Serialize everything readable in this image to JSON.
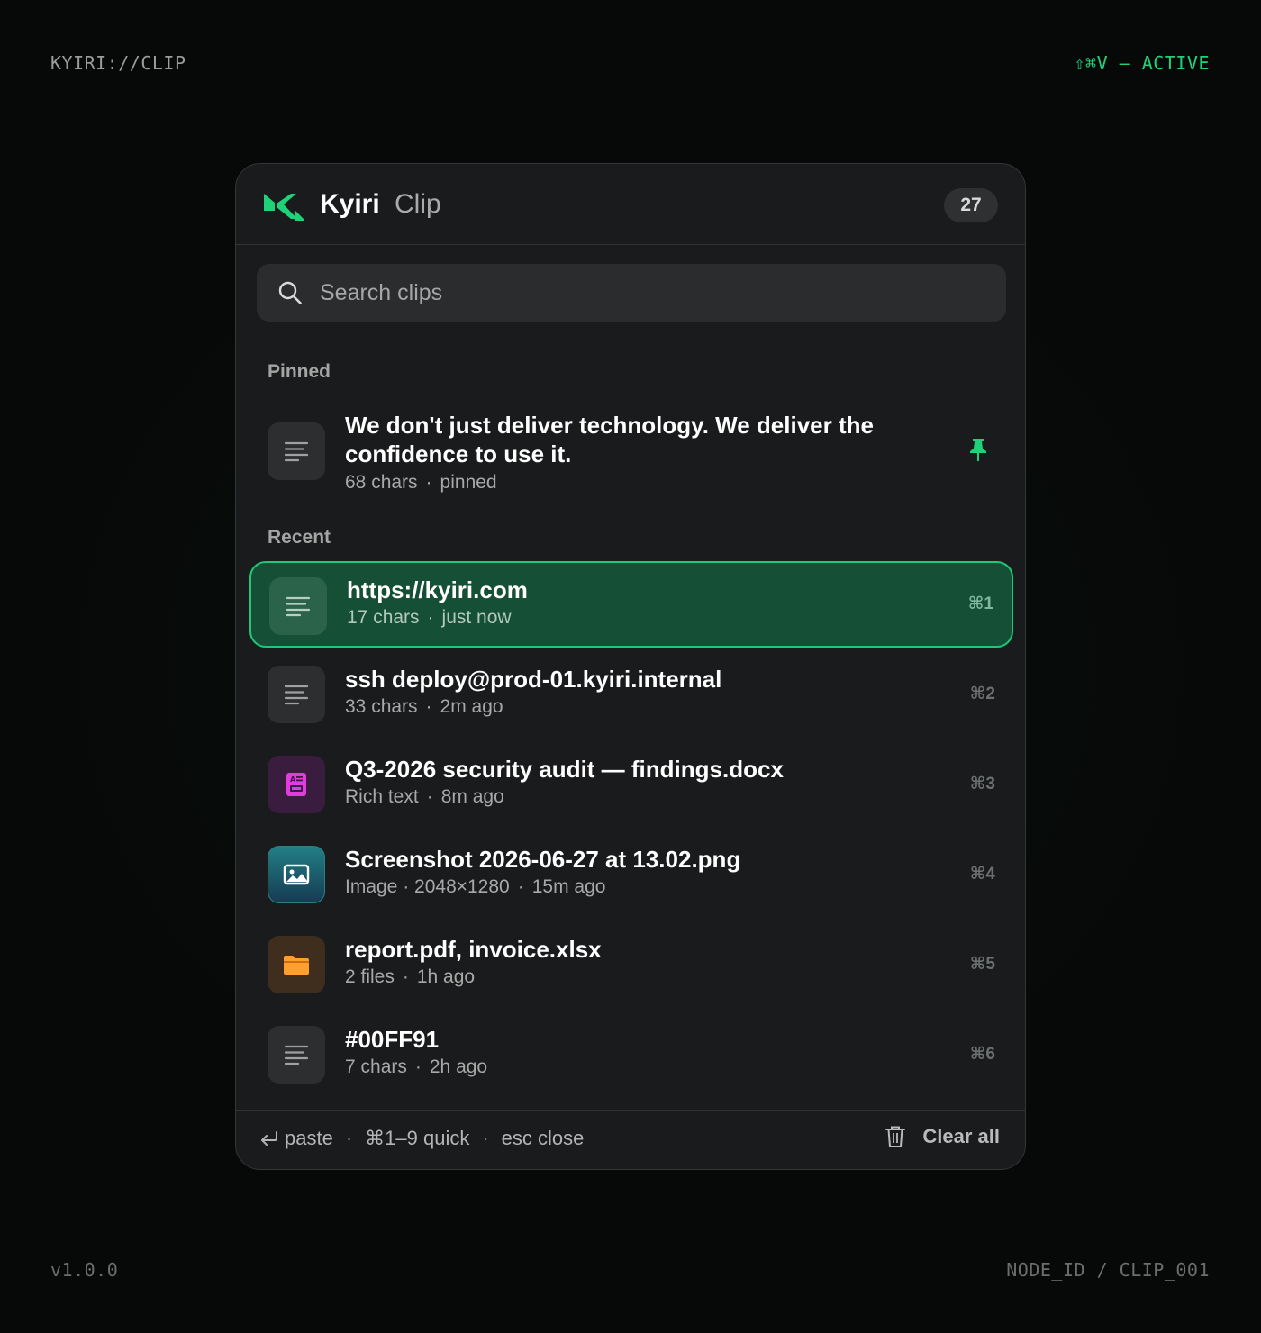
{
  "corners": {
    "top_left": "KYIRI://CLIP",
    "top_right": "⇧⌘V — ACTIVE",
    "bottom_left": "v1.0.0",
    "bottom_right": "NODE_ID / CLIP_001"
  },
  "header": {
    "brand": "Kyiri",
    "product": "Clip",
    "count": "27"
  },
  "search": {
    "placeholder": "Search clips",
    "value": ""
  },
  "sections": {
    "pinned": "Pinned",
    "recent": "Recent"
  },
  "pinned_item": {
    "title": "We don't just deliver technology. We deliver the confidence to use it.",
    "meta_a": "68 chars",
    "meta_b": "pinned",
    "icon": "text-lines-icon"
  },
  "recent_items": [
    {
      "title": "https://kyiri.com",
      "meta_a": "17 chars",
      "meta_b": "just now",
      "shortcut": "⌘1",
      "type": "text",
      "selected": true
    },
    {
      "title": "ssh deploy@prod-01.kyiri.internal",
      "meta_a": "33 chars",
      "meta_b": "2m ago",
      "shortcut": "⌘2",
      "type": "text"
    },
    {
      "title": "Q3-2026 security audit — findings.docx",
      "meta_a": "Rich text",
      "meta_b": "8m ago",
      "shortcut": "⌘3",
      "type": "rich"
    },
    {
      "title": "Screenshot 2026-06-27 at 13.02.png",
      "meta_a": "Image · 2048×1280",
      "meta_b": "15m ago",
      "shortcut": "⌘4",
      "type": "image"
    },
    {
      "title": "report.pdf, invoice.xlsx",
      "meta_a": "2 files",
      "meta_b": "1h ago",
      "shortcut": "⌘5",
      "type": "files"
    },
    {
      "title": "#00FF91",
      "meta_a": "7 chars",
      "meta_b": "2h ago",
      "shortcut": "⌘6",
      "type": "text"
    }
  ],
  "footer": {
    "paste": "paste",
    "quick": "⌘1–9 quick",
    "close": "esc close",
    "separator": "·",
    "clear_all": "Clear all"
  },
  "colors": {
    "accent": "#1FD27A",
    "selected_bg": "#154F36",
    "panel_bg": "#1A1B1C",
    "rich_icon": "#E23BE0",
    "files_icon": "#FF9F2E"
  }
}
